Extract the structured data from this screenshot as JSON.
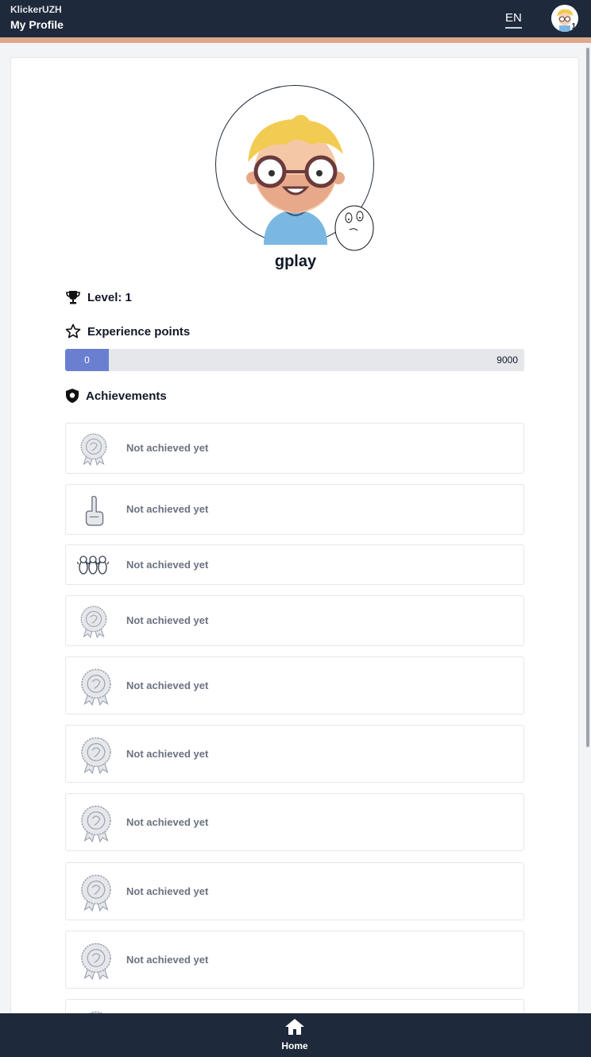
{
  "header": {
    "app_name": "KlickerUZH",
    "page_title": "My Profile",
    "language": "EN",
    "avatar_level": "1"
  },
  "profile": {
    "username": "gplay",
    "level_label": "Level: 1",
    "xp_label": "Experience points",
    "xp_value": "0",
    "xp_max": "9000",
    "xp_progress_fraction": 0,
    "achievements_label": "Achievements"
  },
  "achievements": [
    {
      "status": "Not achieved yet",
      "icon": "medal-question-icon"
    },
    {
      "status": "Not achieved yet",
      "icon": "foam-finger-icon"
    },
    {
      "status": "Not achieved yet",
      "icon": "penguins-icon"
    },
    {
      "status": "Not achieved yet",
      "icon": "medal-icon"
    },
    {
      "status": "Not achieved yet",
      "icon": "medal-rocket-icon"
    },
    {
      "status": "Not achieved yet",
      "icon": "medal-hand-icon"
    },
    {
      "status": "Not achieved yet",
      "icon": "medal-box-icon"
    },
    {
      "status": "Not achieved yet",
      "icon": "medal-bulb-icon"
    },
    {
      "status": "Not achieved yet",
      "icon": "medal-hand-icon"
    },
    {
      "status": "",
      "icon": "medal-icon"
    }
  ],
  "bottom_nav": {
    "home_label": "Home"
  },
  "colors": {
    "topbar": "#1e293b",
    "accent": "#dca98b",
    "xp_fill": "#6b7fd1"
  }
}
